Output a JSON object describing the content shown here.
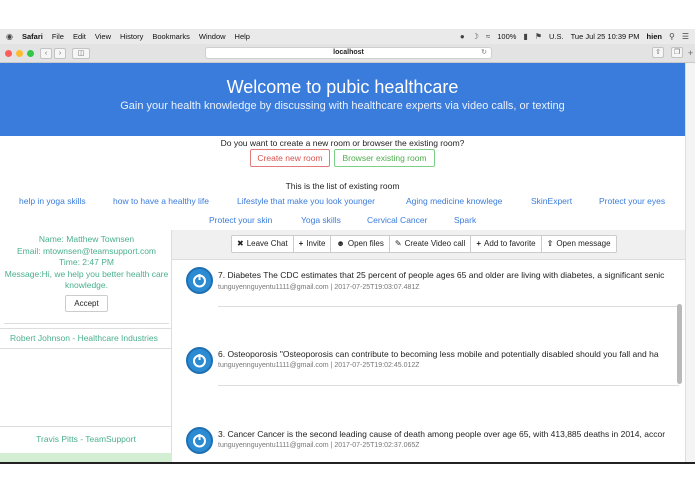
{
  "menubar": {
    "apple": "",
    "app": "Safari",
    "menus": [
      "File",
      "Edit",
      "View",
      "History",
      "Bookmarks",
      "Window",
      "Help"
    ],
    "battery": "100%",
    "region": "U.S.",
    "datetime": "Tue Jul 25  10:39 PM",
    "user": "hien"
  },
  "browser": {
    "url": "localhost",
    "traffic_colors": [
      "#fc5f57",
      "#fdbc2e",
      "#33c748"
    ]
  },
  "hero": {
    "title": "Welcome to pubic healthcare",
    "subtitle": "Gain your health knowledge by discussing with healthcare experts via video calls, or texting"
  },
  "prompt": {
    "question": "Do you want to create a new room or browser the existing room?",
    "create_label": "Create new room",
    "browse_label": "Browser existing room",
    "list_title": "This is the list of existing room"
  },
  "rooms": [
    "help in yoga skills",
    "how to have a healthy life",
    "Lifestyle that make you look younger",
    "Aging medicine knowlege",
    "SkinExpert",
    "Protect your eyes",
    "Protect your skin",
    "Yoga skills",
    "Cervical Cancer",
    "Spark"
  ],
  "request": {
    "name": "Name: Matthew Townsen",
    "email": "Email: mtownsen@teamsupport.com",
    "time": "Time: 2:47 PM",
    "message": "Message:Hi, we help you better health care knowledge.",
    "accept_label": "Accept"
  },
  "contacts": {
    "robert": "Robert Johnson - Healthcare Industries",
    "travis": "Travis Pitts - TeamSupport"
  },
  "toolbar": {
    "leave": "Leave Chat",
    "invite": "Invite",
    "files": "Open files",
    "video": "Create Video call",
    "favorite": "Add to favorite",
    "open_message": "Open message"
  },
  "messages": [
    {
      "text": "7. Diabetes The CDC estimates that 25 percent of people ages 65 and older are living with diabetes, a significant senic",
      "meta": "tunguyennguyentu1111@gmail.com | 2017-07-25T19:03:07.481Z"
    },
    {
      "text": "6. Osteoporosis \"Osteoporosis can contribute to becoming less mobile and potentially disabled should you fall and ha",
      "meta": "tunguyennguyentu1111@gmail.com | 2017-07-25T19:02:45.012Z"
    },
    {
      "text": "3. Cancer Cancer is the second leading cause of death among people over age 65, with 413,885 deaths in 2014, accor",
      "meta": "tunguyennguyentu1111@gmail.com | 2017-07-25T19:02:37.065Z"
    }
  ],
  "colors": {
    "hero_bg": "#3a7cdc",
    "link": "#3a7cdc",
    "contact_green": "#4aaf8f",
    "create_red": "#d9534f",
    "browse_green": "#4cae4c"
  }
}
